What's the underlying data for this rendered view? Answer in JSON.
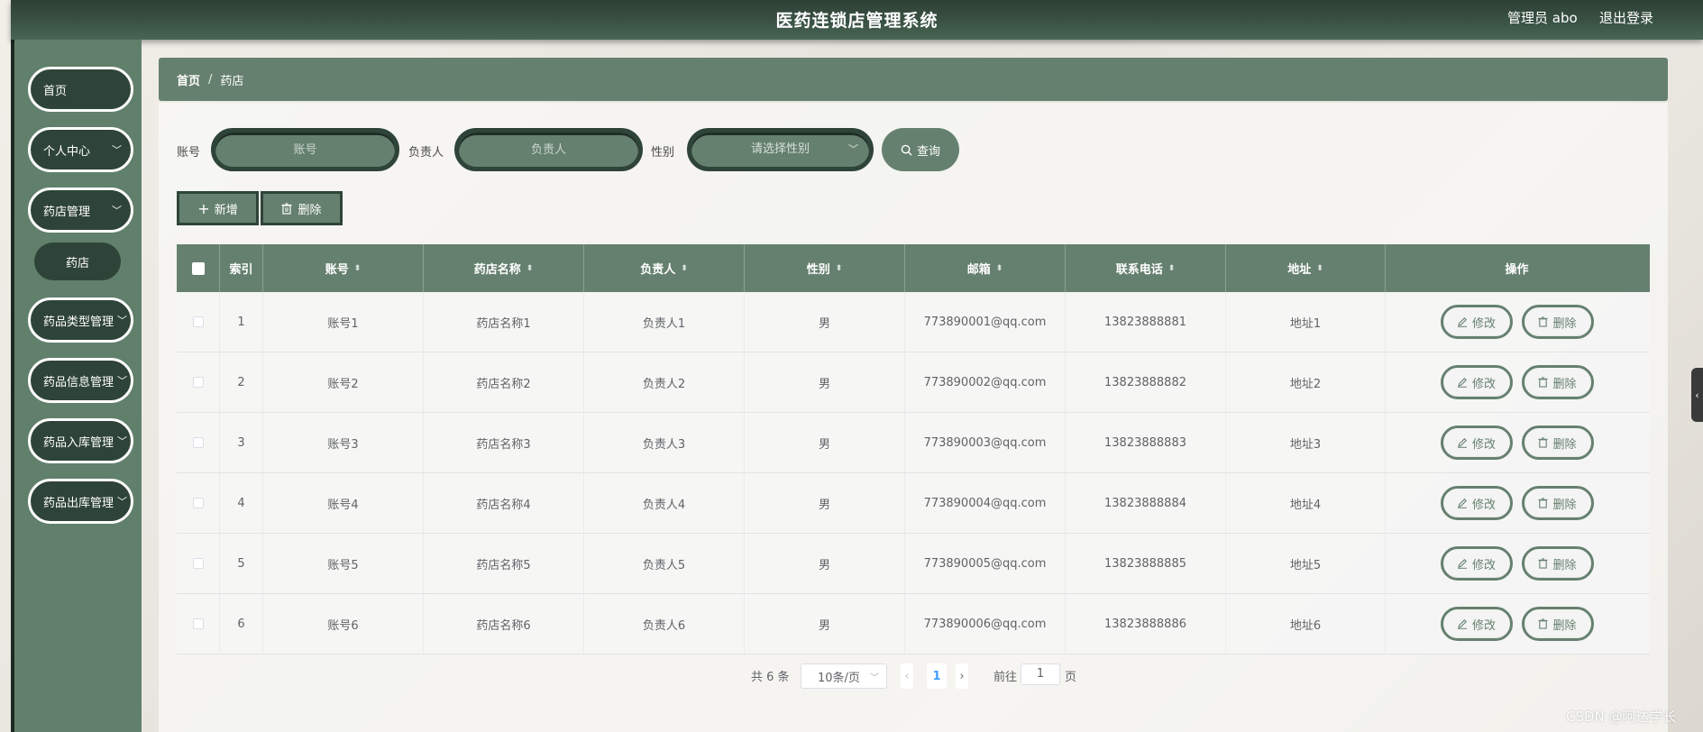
{
  "header": {
    "title": "医药连锁店管理系统",
    "user": "管理员 abo",
    "logout": "退出登录"
  },
  "sidebar": {
    "items": [
      {
        "label": "首页"
      },
      {
        "label": "个人中心"
      },
      {
        "label": "药店管理"
      },
      {
        "label": "药品类型管理"
      },
      {
        "label": "药品信息管理"
      },
      {
        "label": "药品入库管理"
      },
      {
        "label": "药品出库管理"
      }
    ],
    "sub_item": "药店"
  },
  "breadcrumb": {
    "home": "首页",
    "sep": "/",
    "current": "药店"
  },
  "search": {
    "account_label": "账号",
    "account_placeholder": "账号",
    "manager_label": "负责人",
    "manager_placeholder": "负责人",
    "gender_label": "性别",
    "gender_placeholder": "请选择性别",
    "query_label": "查询"
  },
  "toolbar": {
    "add_label": "新增",
    "delete_label": "删除"
  },
  "table": {
    "headers": [
      "索引",
      "账号",
      "药店名称",
      "负责人",
      "性别",
      "邮箱",
      "联系电话",
      "地址",
      "操作"
    ],
    "rows": [
      {
        "idx": "1",
        "account": "账号1",
        "name": "药店名称1",
        "manager": "负责人1",
        "gender": "男",
        "email": "773890001@qq.com",
        "phone": "13823888881",
        "address": "地址1"
      },
      {
        "idx": "2",
        "account": "账号2",
        "name": "药店名称2",
        "manager": "负责人2",
        "gender": "男",
        "email": "773890002@qq.com",
        "phone": "13823888882",
        "address": "地址2"
      },
      {
        "idx": "3",
        "account": "账号3",
        "name": "药店名称3",
        "manager": "负责人3",
        "gender": "男",
        "email": "773890003@qq.com",
        "phone": "13823888883",
        "address": "地址3"
      },
      {
        "idx": "4",
        "account": "账号4",
        "name": "药店名称4",
        "manager": "负责人4",
        "gender": "男",
        "email": "773890004@qq.com",
        "phone": "13823888884",
        "address": "地址4"
      },
      {
        "idx": "5",
        "account": "账号5",
        "name": "药店名称5",
        "manager": "负责人5",
        "gender": "男",
        "email": "773890005@qq.com",
        "phone": "13823888885",
        "address": "地址5"
      },
      {
        "idx": "6",
        "account": "账号6",
        "name": "药店名称6",
        "manager": "负责人6",
        "gender": "男",
        "email": "773890006@qq.com",
        "phone": "13823888886",
        "address": "地址6"
      }
    ],
    "edit_label": "修改",
    "delete_label": "删除"
  },
  "pagination": {
    "total": "共 6 条",
    "page_size": "10条/页",
    "current_page": "1",
    "goto_label": "前往",
    "goto_value": "1",
    "page_suffix": "页"
  },
  "watermark": "CSDN @阿达学长",
  "colors": {
    "primary": "#66806f",
    "dark": "#2f4438",
    "sidebar": "#61806c",
    "active_page": "#409eff"
  }
}
